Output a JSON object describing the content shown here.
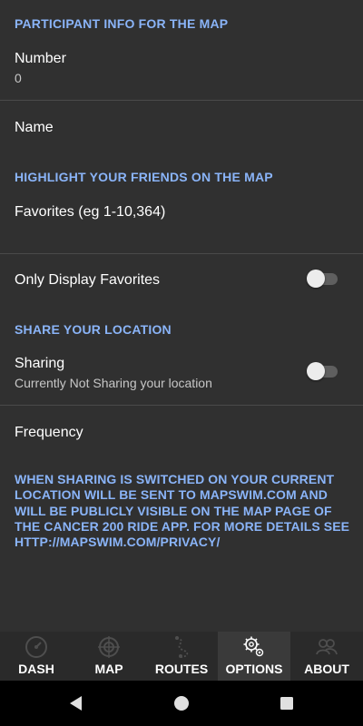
{
  "participant": {
    "header": "PARTICIPANT INFO FOR THE MAP",
    "number_label": "Number",
    "number_value": "0",
    "name_label": "Name"
  },
  "friends": {
    "header": "HIGHLIGHT YOUR FRIENDS ON THE MAP",
    "favorites_label": "Favorites (eg 1-10,364)",
    "only_favorites_label": "Only Display Favorites",
    "only_favorites_on": false
  },
  "location": {
    "header": "SHARE YOUR LOCATION",
    "sharing_label": "Sharing",
    "sharing_summary": "Currently Not Sharing your location",
    "sharing_on": false,
    "frequency_label": "Frequency",
    "notice": "WHEN SHARING IS SWITCHED ON YOUR CURRENT LOCATION WILL BE SENT TO MAPSWIM.COM AND WILL BE PUBLICLY VISIBLE ON THE MAP PAGE OF THE CANCER 200 RIDE APP. FOR MORE DETAILS SEE HTTP://MAPSWIM.COM/PRIVACY/"
  },
  "tabs": [
    {
      "label": "DASH",
      "icon": "speedometer-icon",
      "selected": false
    },
    {
      "label": "MAP",
      "icon": "crosshair-map-icon",
      "selected": false
    },
    {
      "label": "ROUTES",
      "icon": "route-icon",
      "selected": false
    },
    {
      "label": "OPTIONS",
      "icon": "gears-icon",
      "selected": true
    },
    {
      "label": "ABOUT",
      "icon": "people-icon",
      "selected": false
    }
  ],
  "navigation": {
    "back": "back-triangle-icon",
    "home": "home-circle-icon",
    "recents": "recents-square-icon"
  },
  "colors": {
    "background": "#303030",
    "accent": "#8ab4f8",
    "divider": "#4a4a4a",
    "tabbar": "#2a2a2a",
    "tab_selected": "#3a3a3a"
  }
}
